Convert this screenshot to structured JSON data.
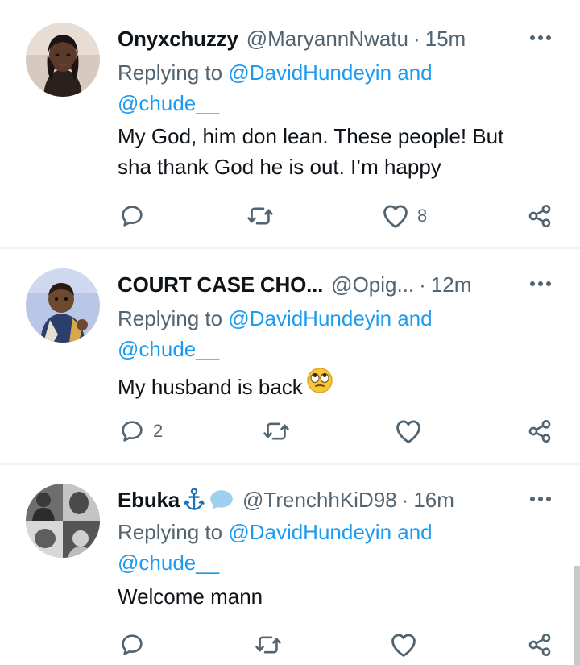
{
  "tweets": [
    {
      "name": "Onyxchuzzy",
      "handle": "@MaryannNwatu",
      "dot": "·",
      "time": "15m",
      "replying_prefix": "Replying to",
      "mention1": "@DavidHundeyin",
      "and": "and",
      "mention2": "@chude__",
      "text_line1": "My God, him don lean. These people! But",
      "text_line2": "sha thank God he is out. I’m happy",
      "reply_count": "",
      "retweet_count": "",
      "like_count": "8"
    },
    {
      "name": "COURT CASE CHO...",
      "handle": "@Opig...",
      "dot": "·",
      "time": "12m",
      "replying_prefix": "Replying to",
      "mention1": "@DavidHundeyin",
      "and": "and",
      "mention2": "@chude__",
      "text_line1": "My husband is back",
      "text_line2": "",
      "emoji": "rolling-eyes-emoji",
      "reply_count": "2",
      "retweet_count": "",
      "like_count": ""
    },
    {
      "name": "Ebuka",
      "name_badges": [
        "anchor-icon",
        "speech-bubble-icon"
      ],
      "handle": "@TrenchhKiD98",
      "dot": "·",
      "time": "16m",
      "replying_prefix": "Replying to",
      "mention1": "@DavidHundeyin",
      "and": "and",
      "mention2": "@chude__",
      "text_line1": "Welcome mann",
      "text_line2": "",
      "reply_count": "",
      "retweet_count": "",
      "like_count": ""
    }
  ],
  "colors": {
    "text": "#0f1419",
    "secondary": "#536471",
    "link": "#1d9bf0",
    "divider": "#eff3f4"
  }
}
